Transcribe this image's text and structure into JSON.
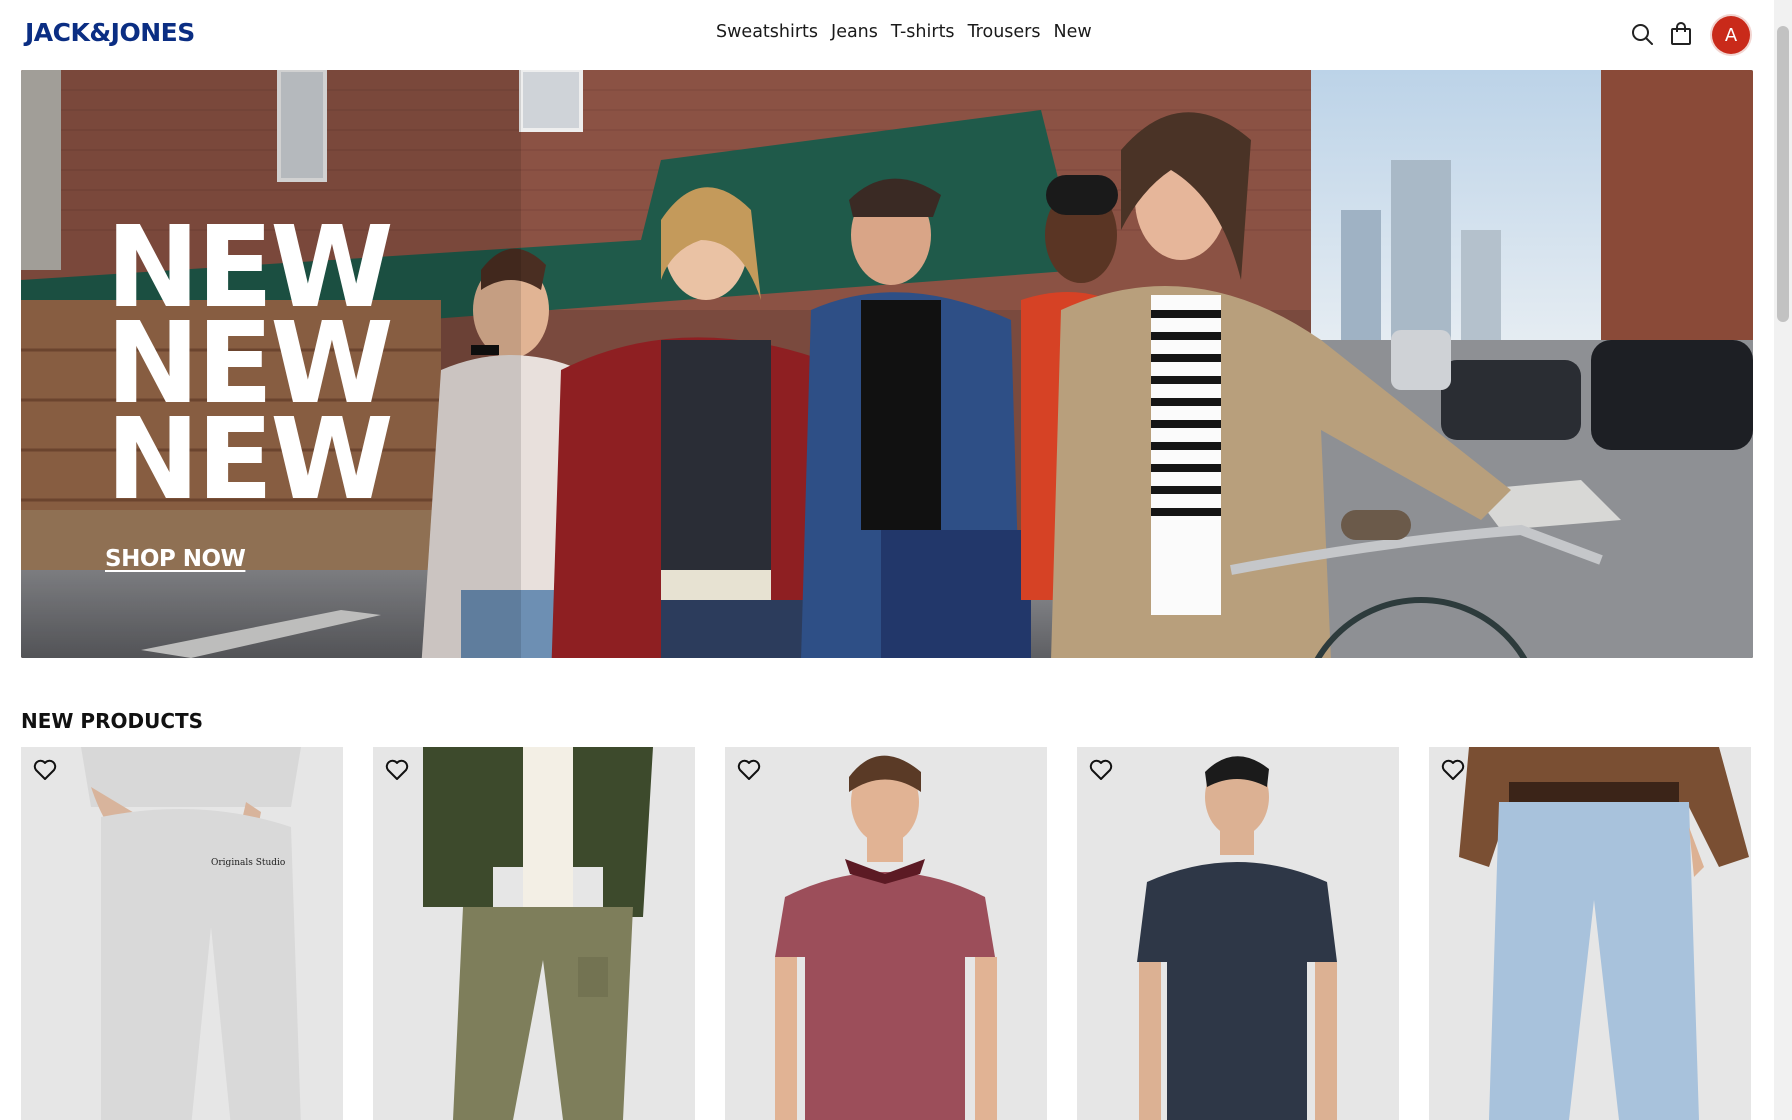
{
  "header": {
    "logo": "JACK&JONES",
    "nav": [
      "Sweatshirts",
      "Jeans",
      "T-shirts",
      "Trousers",
      "New"
    ],
    "search_icon": "search-icon",
    "bag_icon": "shopping-bag-icon",
    "avatar_initial": "A"
  },
  "hero": {
    "title_lines": [
      "NEW",
      "NEW",
      "NEW"
    ],
    "cta": "SHOP NOW"
  },
  "products_section": {
    "title": "NEW PRODUCTS",
    "items": [
      {
        "name": "grey sweatpants",
        "favorite_icon": "heart-icon"
      },
      {
        "name": "olive cargo trousers",
        "favorite_icon": "heart-icon"
      },
      {
        "name": "burgundy polo shirt",
        "favorite_icon": "heart-icon"
      },
      {
        "name": "navy t-shirt",
        "favorite_icon": "heart-icon"
      },
      {
        "name": "light blue jeans",
        "favorite_icon": "heart-icon"
      }
    ]
  },
  "colors": {
    "brand": "#0b2e83",
    "avatar": "#c92a1a"
  }
}
